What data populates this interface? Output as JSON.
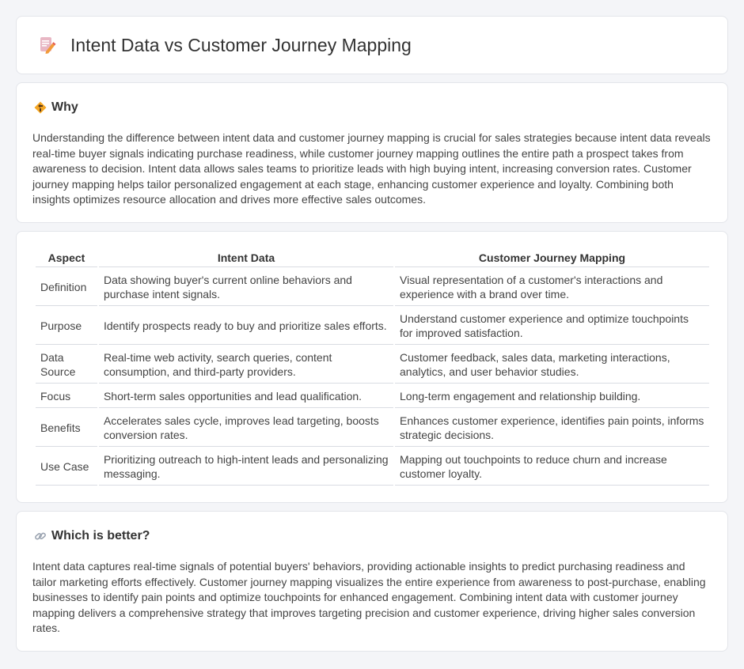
{
  "header": {
    "title": "Intent Data vs Customer Journey Mapping",
    "icon": "document-pencil-icon"
  },
  "why": {
    "heading": "Why",
    "icon": "diamond-sign-icon",
    "text": "Understanding the difference between intent data and customer journey mapping is crucial for sales strategies because intent data reveals real-time buyer signals indicating purchase readiness, while customer journey mapping outlines the entire path a prospect takes from awareness to decision. Intent data allows sales teams to prioritize leads with high buying intent, increasing conversion rates. Customer journey mapping helps tailor personalized engagement at each stage, enhancing customer experience and loyalty. Combining both insights optimizes resource allocation and drives more effective sales outcomes."
  },
  "comparison": {
    "headers": [
      "Aspect",
      "Intent Data",
      "Customer Journey Mapping"
    ],
    "rows": [
      {
        "aspect": "Definition",
        "a": "Data showing buyer's current online behaviors and purchase intent signals.",
        "b": "Visual representation of a customer's interactions and experience with a brand over time."
      },
      {
        "aspect": "Purpose",
        "a": "Identify prospects ready to buy and prioritize sales efforts.",
        "b": "Understand customer experience and optimize touchpoints for improved satisfaction."
      },
      {
        "aspect": "Data Source",
        "a": "Real-time web activity, search queries, content consumption, and third-party providers.",
        "b": "Customer feedback, sales data, marketing interactions, analytics, and user behavior studies."
      },
      {
        "aspect": "Focus",
        "a": "Short-term sales opportunities and lead qualification.",
        "b": "Long-term engagement and relationship building."
      },
      {
        "aspect": "Benefits",
        "a": "Accelerates sales cycle, improves lead targeting, boosts conversion rates.",
        "b": "Enhances customer experience, identifies pain points, informs strategic decisions."
      },
      {
        "aspect": "Use Case",
        "a": "Prioritizing outreach to high-intent leads and personalizing messaging.",
        "b": "Mapping out touchpoints to reduce churn and increase customer loyalty."
      }
    ]
  },
  "better": {
    "heading": "Which is better?",
    "icon": "link-icon",
    "text": "Intent data captures real-time signals of potential buyers' behaviors, providing actionable insights to predict purchasing readiness and tailor marketing efforts effectively. Customer journey mapping visualizes the entire experience from awareness to post-purchase, enabling businesses to identify pain points and optimize touchpoints for enhanced engagement. Combining intent data with customer journey mapping delivers a comprehensive strategy that improves targeting precision and customer experience, driving higher sales conversion rates."
  }
}
